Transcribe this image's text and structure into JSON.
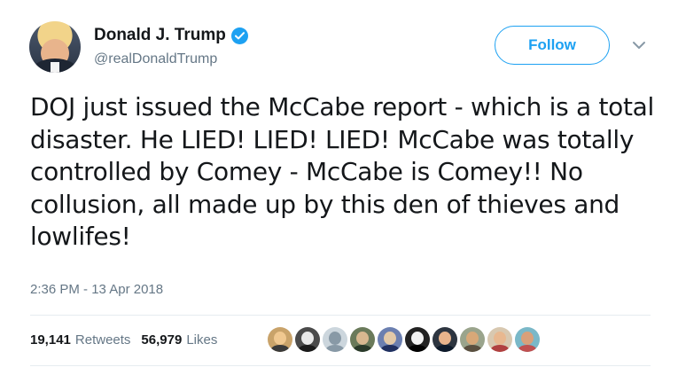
{
  "user": {
    "display_name": "Donald J. Trump",
    "handle": "@realDonaldTrump",
    "verified": true
  },
  "follow_label": "Follow",
  "tweet": {
    "text": "DOJ just issued the McCabe report - which is a total disaster. He LIED! LIED! LIED! McCabe was totally controlled by Comey - McCabe is Comey!! No collusion, all made up by this den of thieves and lowlifes!",
    "timestamp": "2:36 PM - 13 Apr 2018"
  },
  "stats": {
    "retweets_count": "19,141",
    "retweets_label": "Retweets",
    "likes_count": "56,979",
    "likes_label": "Likes"
  },
  "likers": [
    {
      "bg": "#c9a36a",
      "face": "#f0c890",
      "body": "#3a3a3a"
    },
    {
      "bg": "#4a4a4a",
      "face": "#e8e8e8",
      "body": "#1a1a1a"
    },
    {
      "bg": "#ccd6dd",
      "face": "#8899a6",
      "body": "#8899a6"
    },
    {
      "bg": "#6a7a5a",
      "face": "#d8b890",
      "body": "#2a3a2a"
    },
    {
      "bg": "#6b7fb0",
      "face": "#e2c9a8",
      "body": "#203060"
    },
    {
      "bg": "#222222",
      "face": "#f2f2f2",
      "body": "#000000"
    },
    {
      "bg": "#2d3540",
      "face": "#e8b48c",
      "body": "#0d1a2a"
    },
    {
      "bg": "#9aa48c",
      "face": "#d8a878",
      "body": "#5a5040"
    },
    {
      "bg": "#d8c8b0",
      "face": "#e8b890",
      "body": "#b04040"
    },
    {
      "bg": "#7ab8c8",
      "face": "#d9a07a",
      "body": "#c05050"
    }
  ],
  "colors": {
    "accent": "#1da1f2",
    "secondary_text": "#657786",
    "divider": "#e6ecf0"
  },
  "icons": {
    "verified": "verified-badge-icon",
    "more": "chevron-down-icon"
  }
}
